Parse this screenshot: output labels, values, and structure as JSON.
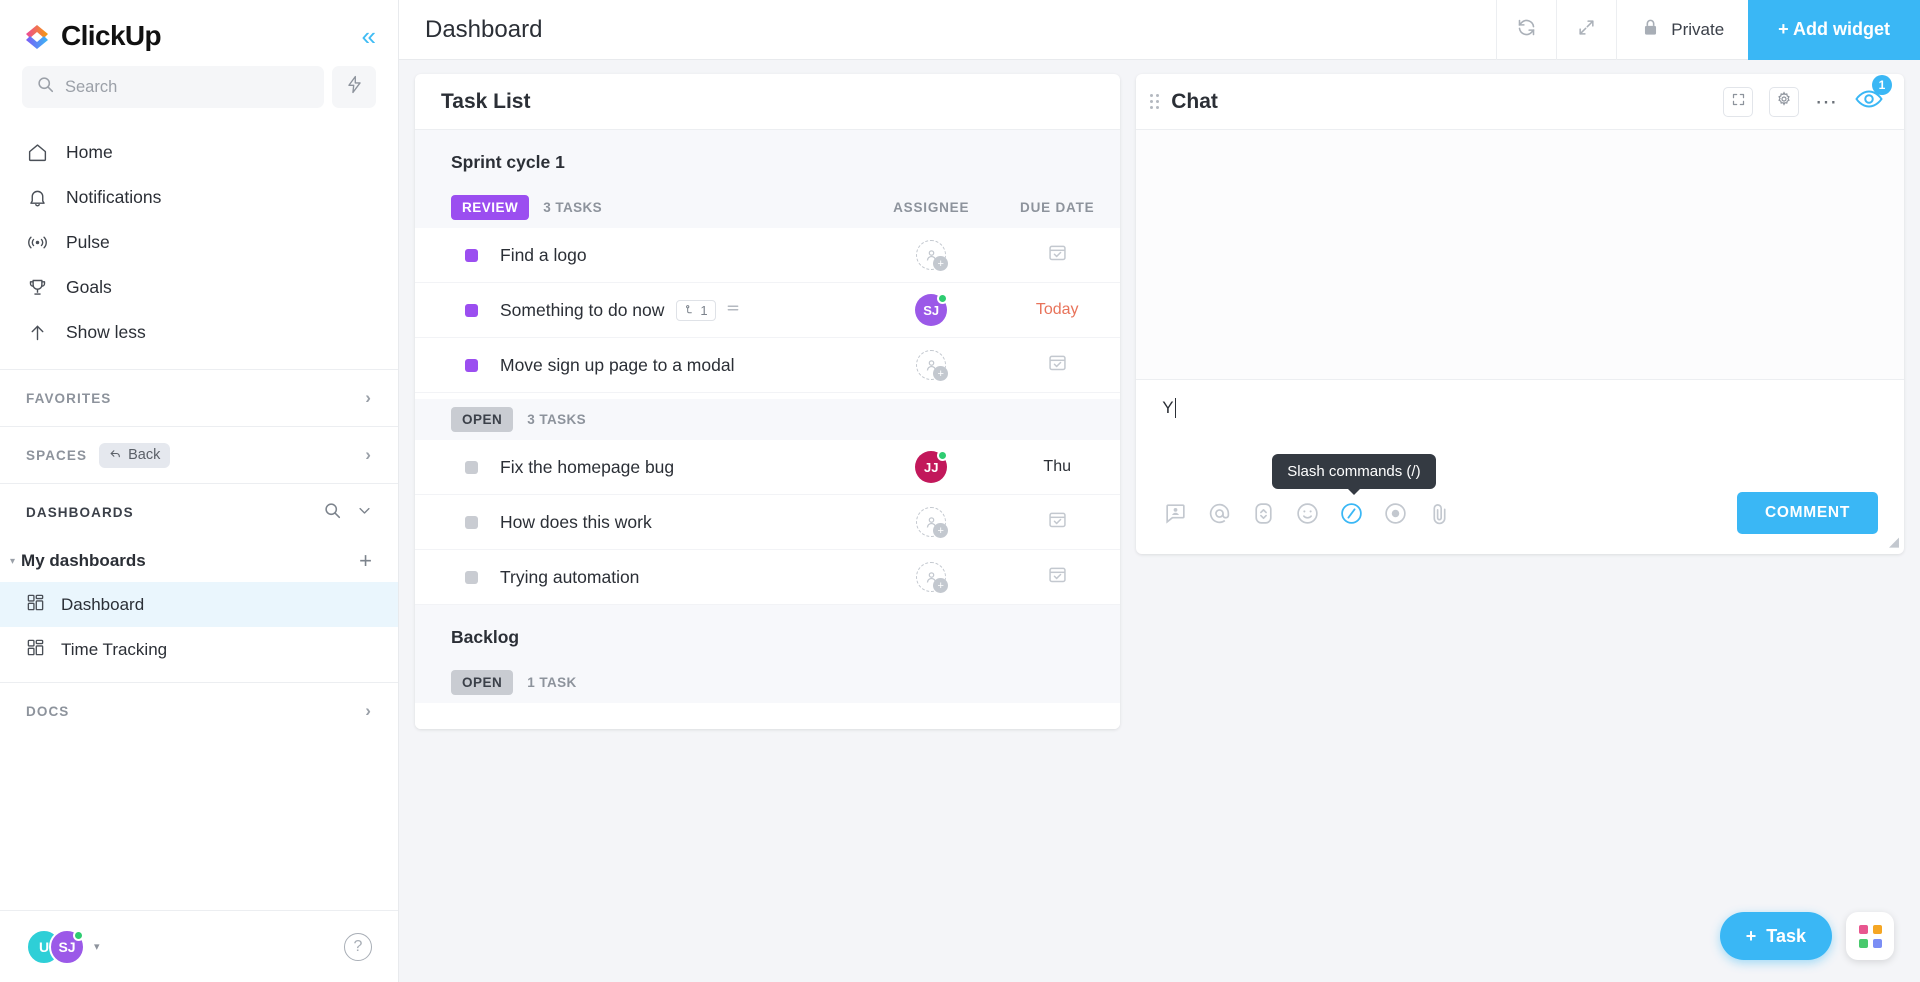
{
  "brand": {
    "name": "ClickUp",
    "accent": "#3ab7f5",
    "purple": "#9b4ef0"
  },
  "sidebar": {
    "search": {
      "placeholder": "Search",
      "value": ""
    },
    "nav": [
      {
        "label": "Home",
        "icon": "home-icon"
      },
      {
        "label": "Notifications",
        "icon": "bell-icon"
      },
      {
        "label": "Pulse",
        "icon": "pulse-icon"
      },
      {
        "label": "Goals",
        "icon": "trophy-icon"
      },
      {
        "label": "Show less",
        "icon": "arrow-up-icon"
      }
    ],
    "sections": {
      "favorites": "FAVORITES",
      "spaces": "SPACES",
      "spaces_back": "Back",
      "dashboards": "DASHBOARDS",
      "docs": "DOCS"
    },
    "my_dashboards": "My dashboards",
    "dashboard_items": [
      {
        "label": "Dashboard",
        "active": true
      },
      {
        "label": "Time Tracking",
        "active": false
      }
    ],
    "footer": {
      "avatar_1": "U",
      "avatar_2": "SJ",
      "help": "?"
    }
  },
  "topbar": {
    "title": "Dashboard",
    "private_label": "Private",
    "add_widget_label": "+ Add widget",
    "refresh_icon": "refresh-icon",
    "expand_icon": "expand-icon",
    "lock_icon": "lock-icon"
  },
  "task_widget": {
    "title": "Task List",
    "columns": [
      "ASSIGNEE",
      "DUE DATE"
    ],
    "groups": [
      {
        "name": "Sprint cycle 1",
        "statuses": [
          {
            "status": "REVIEW",
            "style": "review",
            "count_label": "3 TASKS",
            "tasks": [
              {
                "name": "Find a logo",
                "assignee": null,
                "due": null
              },
              {
                "name": "Something to do now",
                "assignee": {
                  "initials": "SJ",
                  "color": "#9b59e8",
                  "online": true
                },
                "due": "Today",
                "due_style": "today",
                "subtask_count": "1"
              },
              {
                "name": "Move sign up page to a modal",
                "assignee": null,
                "due": null
              }
            ]
          },
          {
            "status": "OPEN",
            "style": "open",
            "count_label": "3 TASKS",
            "tasks": [
              {
                "name": "Fix the homepage bug",
                "assignee": {
                  "initials": "JJ",
                  "color": "#c2185b",
                  "online": true
                },
                "due": "Thu",
                "due_style": "plain"
              },
              {
                "name": "How does this work",
                "assignee": null,
                "due": null
              },
              {
                "name": "Trying automation",
                "assignee": null,
                "due": null
              }
            ]
          }
        ]
      },
      {
        "name": "Backlog",
        "statuses": [
          {
            "status": "OPEN",
            "style": "open",
            "count_label": "1 TASK",
            "tasks": []
          }
        ]
      }
    ]
  },
  "chat_widget": {
    "title": "Chat",
    "badge_count": "1",
    "composer_value": "Y",
    "tooltip": "Slash commands (/)",
    "comment_button": "COMMENT",
    "toolbar_icons": [
      "assign-comment-icon",
      "mention-icon",
      "task-icon",
      "emoji-icon",
      "slash-command-icon",
      "record-icon",
      "attachment-icon"
    ]
  },
  "fab": {
    "task_label": "Task",
    "apps_icon": "apps-grid-icon"
  }
}
